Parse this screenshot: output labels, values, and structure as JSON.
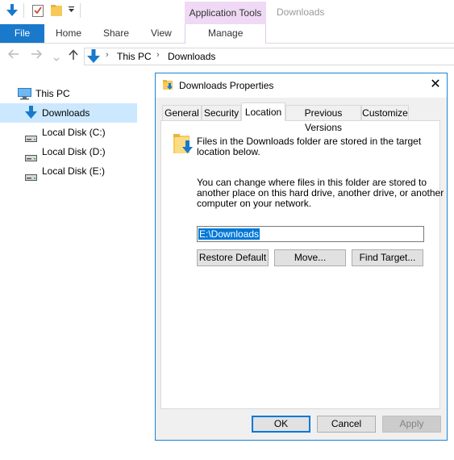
{
  "title_bar": {
    "context_tab_group": "Application Tools",
    "window_title": "Downloads"
  },
  "ribbon": {
    "tabs": [
      {
        "label": "File"
      },
      {
        "label": "Home"
      },
      {
        "label": "Share"
      },
      {
        "label": "View"
      },
      {
        "label": "Manage"
      }
    ]
  },
  "address": {
    "crumbs": [
      "This PC",
      "Downloads"
    ]
  },
  "nav_pane": {
    "items": [
      {
        "label": "This PC",
        "icon": "computer-icon"
      },
      {
        "label": "Downloads",
        "icon": "downloads-icon",
        "selected": true
      },
      {
        "label": "Local Disk (C:)",
        "icon": "drive-icon"
      },
      {
        "label": "Local Disk (D:)",
        "icon": "drive-icon"
      },
      {
        "label": "Local Disk (E:)",
        "icon": "drive-icon"
      }
    ]
  },
  "dialog": {
    "title": "Downloads Properties",
    "close_glyph": "✕",
    "tabs": [
      "General",
      "Security",
      "Location",
      "Previous Versions",
      "Customize"
    ],
    "active_tab": "Location",
    "info_line1": "Files in the Downloads folder are stored in the target",
    "info_line2": "location below.",
    "desc_line1": "You can change where files in this folder are stored to",
    "desc_line2": "another place on this hard drive, another drive, or another",
    "desc_line3": "computer on your network.",
    "path_value": "E:\\Downloads",
    "buttons": {
      "restore_default": "Restore Default",
      "move": "Move...",
      "find_target": "Find Target...",
      "ok": "OK",
      "cancel": "Cancel",
      "apply": "Apply"
    }
  },
  "colors": {
    "accent": "#1979ca",
    "context_tab": "#f0d9f5",
    "selection": "#cce8ff",
    "dialog_border": "#1883d7",
    "folder": "#f5c95a"
  }
}
